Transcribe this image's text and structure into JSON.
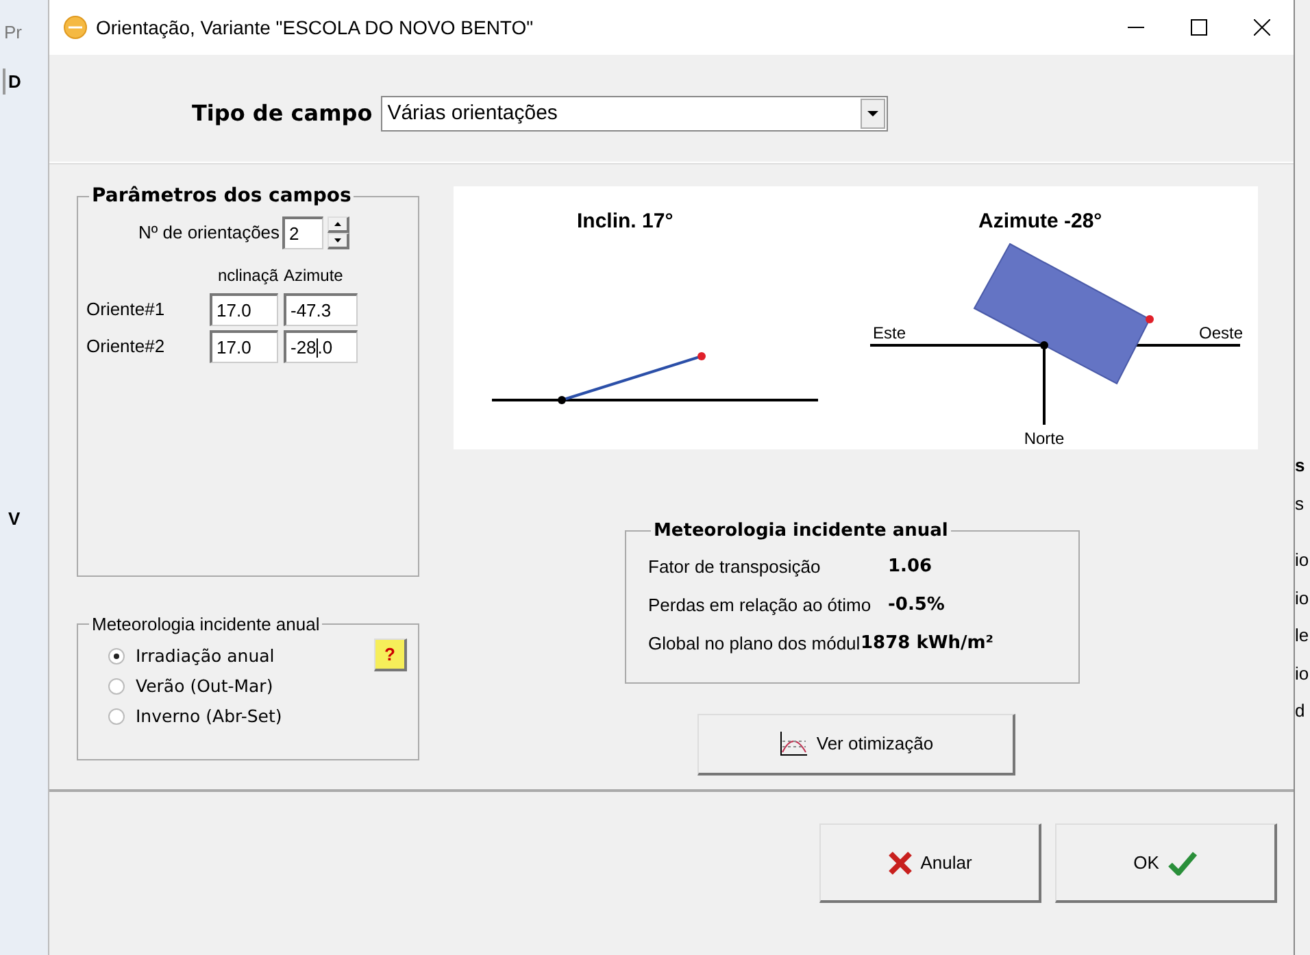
{
  "background_app": {
    "left_fragments": [
      "Pr",
      "D",
      "V"
    ],
    "right_fragments": [
      "s",
      "s",
      "io",
      "io",
      "le",
      "io",
      "d"
    ]
  },
  "window": {
    "title": "Orientação, Variante \"ESCOLA DO NOVO BENTO\""
  },
  "field_type": {
    "label": "Tipo de campo",
    "value": "Várias orientações"
  },
  "field_params": {
    "title": "Parâmetros dos campos",
    "count_label": "Nº de orientações",
    "count_value": "2",
    "columns": [
      "nclinaçã",
      "Azimute"
    ],
    "rows": [
      {
        "label": "Oriente#1",
        "tilt": "17.0",
        "azimuth": "-47.3",
        "focused": false
      },
      {
        "label": "Oriente#2",
        "tilt": "17.0",
        "azimuth": "-28.0",
        "focused": true
      }
    ]
  },
  "meteo_choice": {
    "title": "Meteorologia incidente anual",
    "help": "?",
    "options": [
      {
        "label": "Irradiação anual",
        "selected": true
      },
      {
        "label": "Verão (Out-Mar)",
        "selected": false
      },
      {
        "label": "Inverno (Abr-Set)",
        "selected": false
      }
    ]
  },
  "diagram": {
    "tilt_title": "Inclin. 17°",
    "azimuth_title": "Azimute -28°",
    "east": "Este",
    "west": "Oeste",
    "north": "Norte"
  },
  "results": {
    "title": "Meteorologia incidente anual",
    "rows": [
      {
        "label": "Fator de transposição",
        "value": "1.06"
      },
      {
        "label": "Perdas em relação ao ótimo",
        "value": "-0.5%"
      },
      {
        "label": "Global no plano dos módul",
        "value": "1878 kWh/m²"
      }
    ]
  },
  "optimize_button": "Ver otimização",
  "buttons": [
    {
      "kind": "cancel",
      "label": "Anular"
    },
    {
      "kind": "ok",
      "label": "OK"
    }
  ]
}
